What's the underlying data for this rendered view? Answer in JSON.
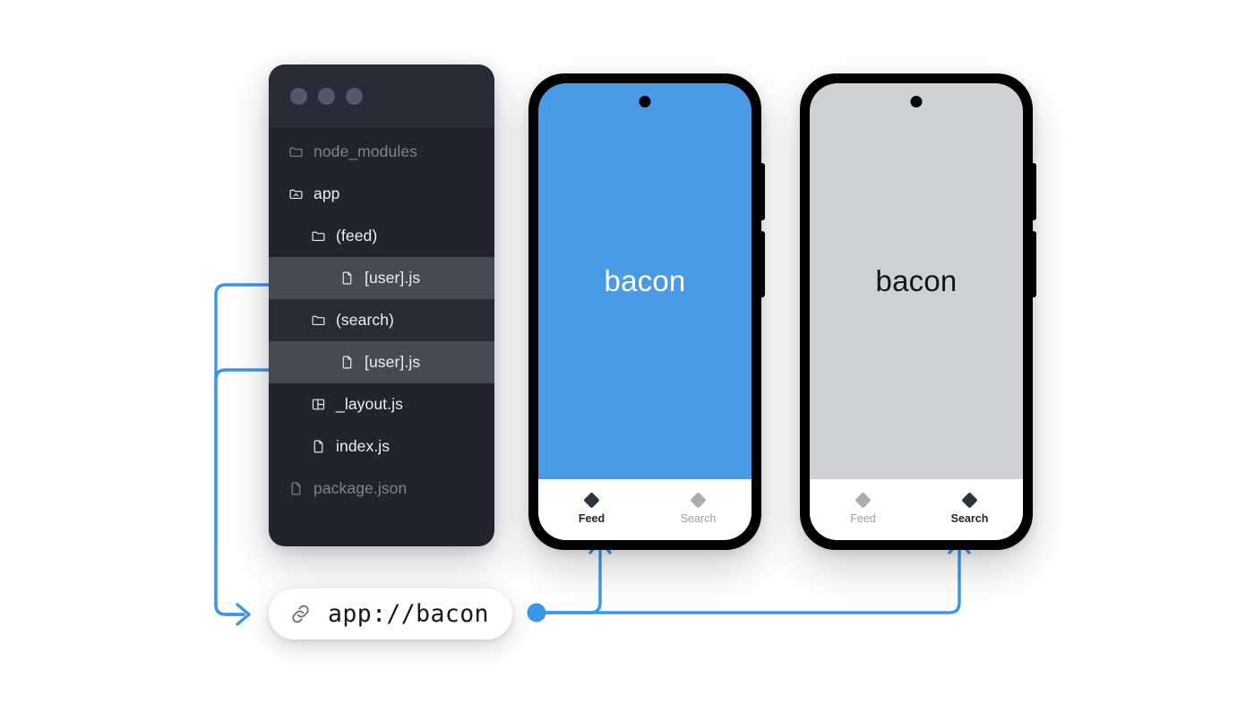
{
  "editor": {
    "window_controls": [
      "close",
      "minimize",
      "maximize"
    ],
    "tree": [
      {
        "label": "node_modules",
        "icon": "folder-icon",
        "indent": 0,
        "state": "dimmed",
        "marker": false
      },
      {
        "label": "app",
        "icon": "folder-open-icon",
        "indent": 0,
        "state": "normal",
        "marker": false
      },
      {
        "label": "(feed)",
        "icon": "folder-icon",
        "indent": 1,
        "state": "normal",
        "marker": false
      },
      {
        "label": "[user].js",
        "icon": "file-icon",
        "indent": 2,
        "state": "highlighted",
        "marker": true
      },
      {
        "label": "(search)",
        "icon": "folder-icon",
        "indent": 1,
        "state": "subtle",
        "marker": false
      },
      {
        "label": "[user].js",
        "icon": "file-icon",
        "indent": 2,
        "state": "highlighted",
        "marker": true
      },
      {
        "label": "_layout.js",
        "icon": "layout-icon",
        "indent": 1,
        "state": "normal",
        "marker": false
      },
      {
        "label": "index.js",
        "icon": "file-icon",
        "indent": 1,
        "state": "normal",
        "marker": false
      },
      {
        "label": "package.json",
        "icon": "file-icon",
        "indent": 0,
        "state": "dimmed",
        "marker": false
      }
    ]
  },
  "phones": [
    {
      "id": "phone-feed",
      "screen_color": "#4a9ae8",
      "content_title": "bacon",
      "content_text_color": "#ffffff",
      "tabs": [
        {
          "label": "Feed",
          "active": true
        },
        {
          "label": "Search",
          "active": false
        }
      ]
    },
    {
      "id": "phone-search",
      "screen_color": "#ced2d6",
      "content_title": "bacon",
      "content_text_color": "#111418",
      "tabs": [
        {
          "label": "Feed",
          "active": false
        },
        {
          "label": "Search",
          "active": true
        }
      ]
    }
  ],
  "url_pill": {
    "icon": "link-icon",
    "url": "app://bacon"
  },
  "colors": {
    "accent": "#3b96e8",
    "editor_bg": "#21232e",
    "editor_titlebar": "#282b38",
    "editor_row_highlight": "#464a57",
    "phone_blue": "#4a9ae8",
    "phone_gray": "#ced2d6"
  }
}
